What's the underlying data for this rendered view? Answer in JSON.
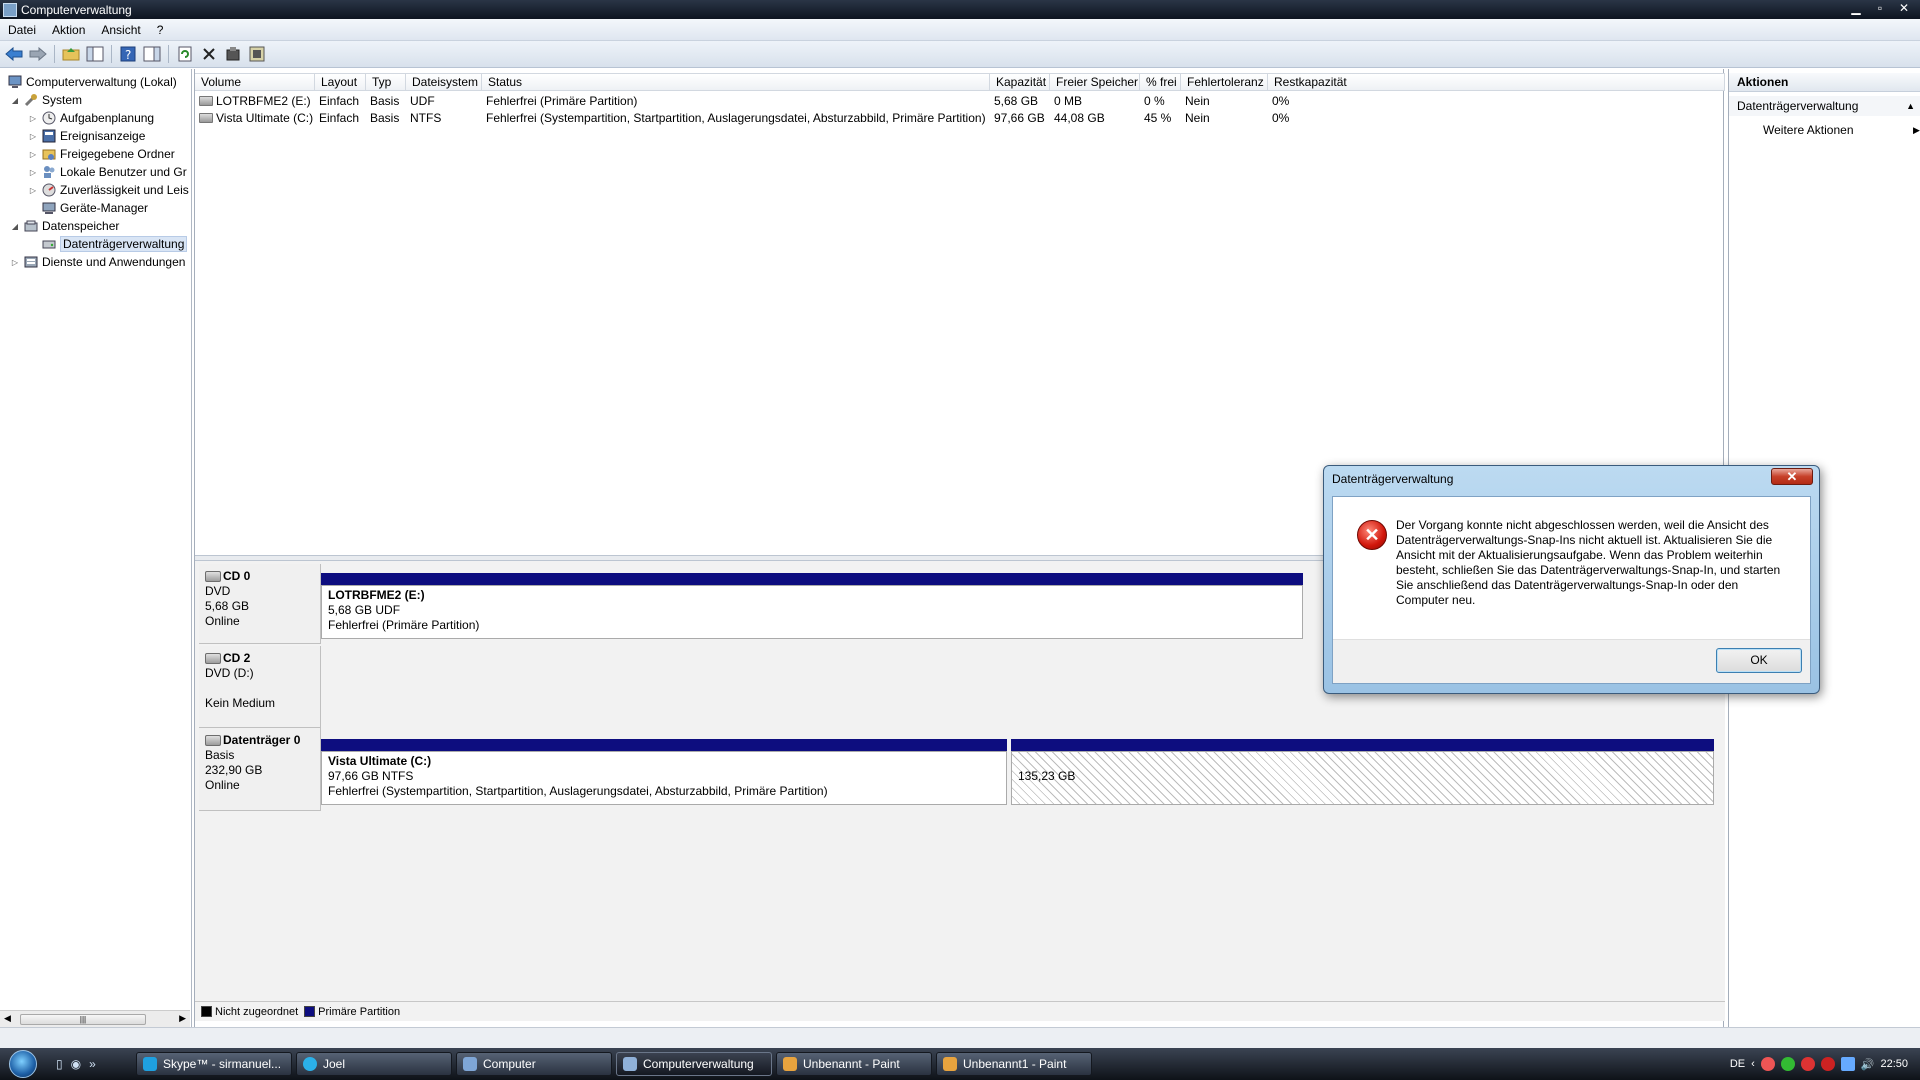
{
  "window": {
    "title": "Computerverwaltung",
    "minimize": "▁",
    "maximize": "▫",
    "close": "✕"
  },
  "menu": [
    "Datei",
    "Aktion",
    "Ansicht",
    "?"
  ],
  "tree": {
    "root": "Computerverwaltung (Lokal)",
    "system": "System",
    "aufgaben": "Aufgabenplanung",
    "ereignis": "Ereignisanzeige",
    "freigegeben": "Freigegebene Ordner",
    "benutzer": "Lokale Benutzer und Gr",
    "zuverl": "Zuverlässigkeit und Leis",
    "geraete": "Geräte-Manager",
    "datenspeicher": "Datenspeicher",
    "dtv": "Datenträgerverwaltung",
    "dienste": "Dienste und Anwendungen",
    "scroll_grip": "|||"
  },
  "volume_table": {
    "headers": [
      "Volume",
      "Layout",
      "Typ",
      "Dateisystem",
      "Status",
      "Kapazität",
      "Freier Speicher",
      "% frei",
      "Fehlertoleranz",
      "Restkapazität"
    ],
    "rows": [
      [
        "LOTRBFME2 (E:)",
        "Einfach",
        "Basis",
        "UDF",
        "Fehlerfrei (Primäre Partition)",
        "5,68 GB",
        "0 MB",
        "0 %",
        "Nein",
        "0%"
      ],
      [
        "Vista Ultimate (C:)",
        "Einfach",
        "Basis",
        "NTFS",
        "Fehlerfrei (Systempartition, Startpartition, Auslagerungsdatei, Absturzabbild, Primäre Partition)",
        "97,66 GB",
        "44,08 GB",
        "45 %",
        "Nein",
        "0%"
      ]
    ]
  },
  "disks": {
    "cd0": {
      "name": "CD 0",
      "type": "DVD",
      "size": "5,68 GB",
      "state": "Online",
      "part": {
        "name": "LOTRBFME2  (E:)",
        "size": "5,68 GB UDF",
        "status": "Fehlerfrei (Primäre Partition)"
      }
    },
    "cd2": {
      "name": "CD 2",
      "type": "DVD (D:)",
      "state": "Kein Medium"
    },
    "disk0": {
      "name": "Datenträger 0",
      "type": "Basis",
      "size": "232,90 GB",
      "state": "Online",
      "part": {
        "name": "Vista Ultimate  (C:)",
        "size": "97,66 GB NTFS",
        "status": "Fehlerfrei (Systempartition, Startpartition, Auslagerungsdatei, Absturzabbild, Primäre Partition)"
      },
      "unalloc": "135,23 GB"
    }
  },
  "legend": {
    "unallocated": "Nicht zugeordnet",
    "primary": "Primäre Partition"
  },
  "actions": {
    "header": "Aktionen",
    "section": "Datenträgerverwaltung",
    "more": "Weitere Aktionen"
  },
  "dialog": {
    "title": "Datenträgerverwaltung",
    "close": "✕",
    "message": "Der Vorgang konnte nicht abgeschlossen werden, weil die Ansicht des Datenträgerverwaltungs-Snap-Ins nicht aktuell ist. Aktualisieren Sie die Ansicht mit der Aktualisierungsaufgabe. Wenn das Problem weiterhin besteht, schließen Sie das Datenträgerverwaltungs-Snap-In, und starten Sie anschließend das Datenträgerverwaltungs-Snap-In oder den Computer neu.",
    "ok": "OK"
  },
  "taskbar": {
    "quick_more": "»",
    "tasks": [
      "Skype™ - sirmanuel...",
      "Joel",
      "Computer",
      "Computerverwaltung",
      "Unbenannt - Paint",
      "Unbenannt1 - Paint"
    ],
    "lang": "DE",
    "clock": "22:50"
  },
  "colors": {
    "primary_partition": "#0d0d7f",
    "unallocated": "#000000",
    "error_red": "#d1160b"
  }
}
